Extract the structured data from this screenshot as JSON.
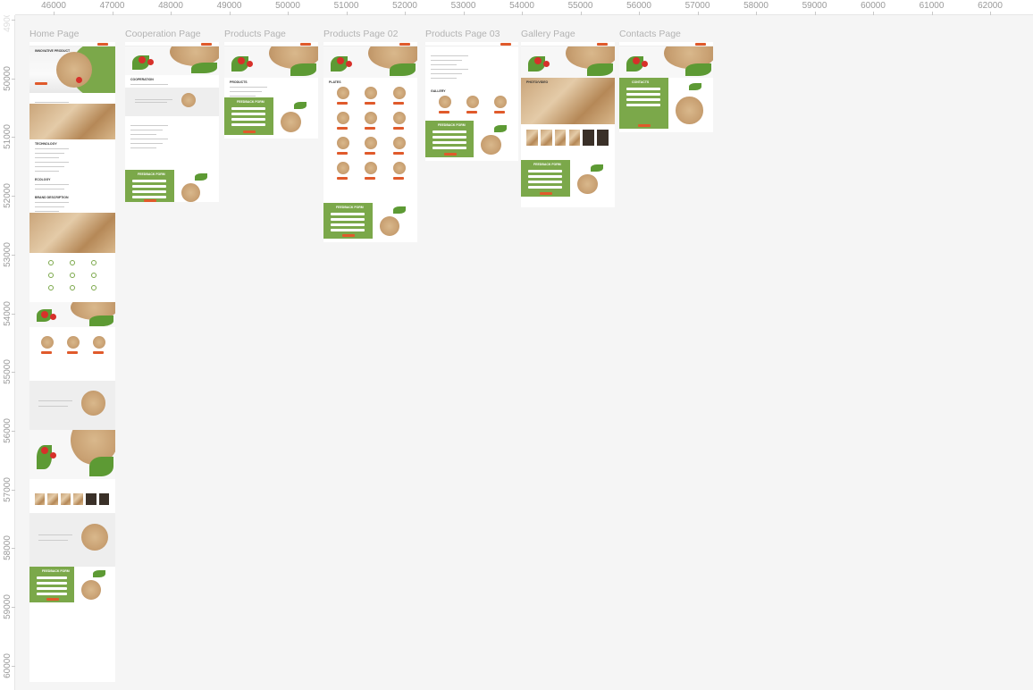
{
  "ruler": {
    "x_ticks": [
      "46000",
      "47000",
      "48000",
      "49000",
      "50000",
      "51000",
      "52000",
      "53000",
      "54000",
      "55000",
      "56000",
      "57000",
      "58000",
      "59000",
      "60000",
      "61000",
      "62000"
    ],
    "y_ticks": [
      "49000",
      "50000",
      "51000",
      "52000",
      "53000",
      "54000",
      "55000",
      "56000",
      "57000",
      "58000",
      "59000",
      "60000"
    ]
  },
  "frames": [
    {
      "name": "Home Page",
      "headings": [
        "INNOVATIVE PRODUCT",
        "ABOUT US",
        "TECHNOLOGY",
        "ECOLOGY",
        "BRAND DESCRIPTION",
        "FEEDBACK FORM"
      ]
    },
    {
      "name": "Cooperation Page",
      "headings": [
        "COOPERATION",
        "FEEDBACK FORM"
      ]
    },
    {
      "name": "Products Page",
      "headings": [
        "PRODUCTS",
        "FEEDBACK FORM"
      ]
    },
    {
      "name": "Products Page 02",
      "headings": [
        "PLATES",
        "FEEDBACK FORM"
      ]
    },
    {
      "name": "Products Page 03",
      "headings": [
        "GALLERY",
        "FEEDBACK FORM"
      ]
    },
    {
      "name": "Gallery Page",
      "headings": [
        "PHOTO/VIDEO",
        "FEEDBACK FORM"
      ]
    },
    {
      "name": "Contacts Page",
      "headings": [
        "CONTACTS",
        "FEEDBACK FORM"
      ]
    }
  ],
  "colors": {
    "brand_green": "#7ba84a",
    "accent_orange": "#e05a2b",
    "canvas": "#f5f5f5"
  }
}
